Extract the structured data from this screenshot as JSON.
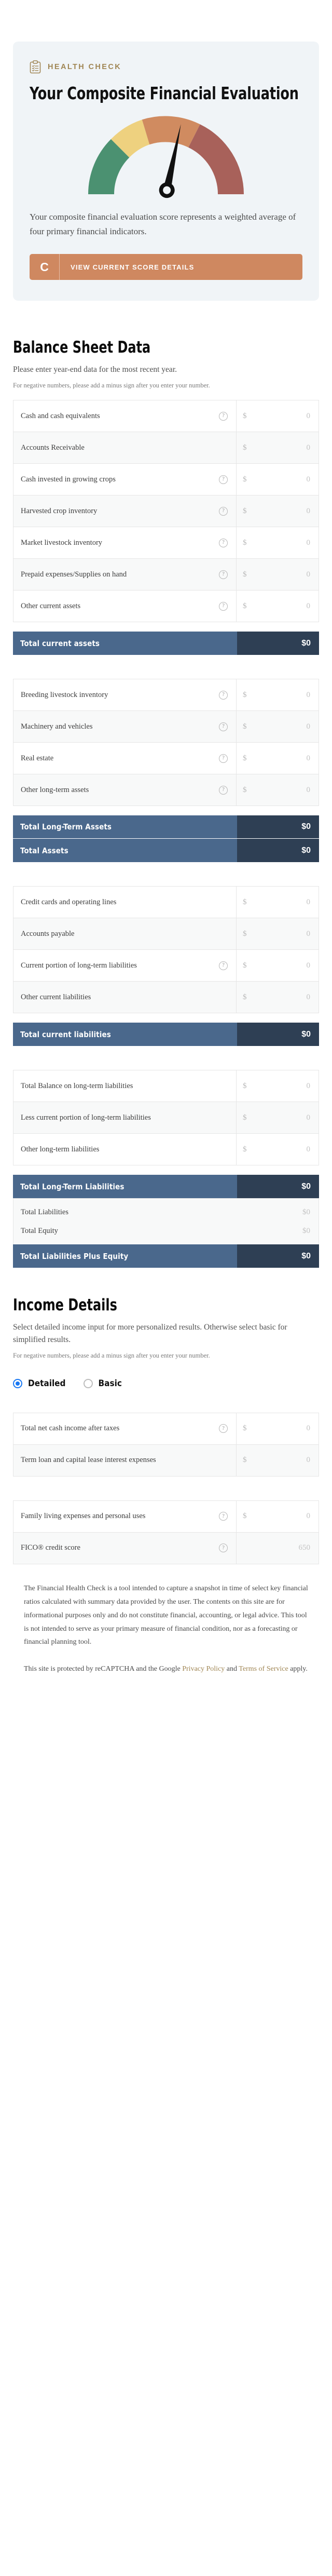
{
  "health_check": {
    "eyebrow": "HEALTH CHECK",
    "icon": "clipboard-check-icon",
    "title": "Your Composite Financial Evaluation",
    "description": "Your composite financial evaluation score represents a weighted average of four primary financial indicators.",
    "grade": "C",
    "button_label": "VIEW CURRENT SCORE DETAILS",
    "gauge": {
      "needle_angle_deg": 12,
      "segments": [
        {
          "name": "strong",
          "color": "#4b9171",
          "start_deg": -90,
          "end_deg": -45
        },
        {
          "name": "stable",
          "color": "#eed17f",
          "start_deg": -45,
          "end_deg": -13
        },
        {
          "name": "caution",
          "color": "#d08b60",
          "start_deg": -13,
          "end_deg": 26
        },
        {
          "name": "weak",
          "color": "#a8615a",
          "start_deg": 26,
          "end_deg": 90
        }
      ]
    }
  },
  "balance_sheet": {
    "title": "Balance Sheet Data",
    "subtitle": "Please enter year-end data for the most recent year.",
    "note": "For negative numbers, please add a minus sign after you enter your number.",
    "currency_symbol": "$",
    "amount_placeholder": "0",
    "help_glyph": "?",
    "current_assets": [
      {
        "label": "Cash and cash equivalents",
        "help": true,
        "value": ""
      },
      {
        "label": "Accounts Receivable",
        "help": false,
        "value": ""
      },
      {
        "label": "Cash invested in growing crops",
        "help": true,
        "value": ""
      },
      {
        "label": "Harvested crop inventory",
        "help": true,
        "value": ""
      },
      {
        "label": "Market livestock inventory",
        "help": true,
        "value": ""
      },
      {
        "label": "Prepaid expenses/Supplies on hand",
        "help": true,
        "value": ""
      },
      {
        "label": "Other current assets",
        "help": true,
        "value": ""
      }
    ],
    "current_assets_total": {
      "label": "Total current assets",
      "value": "$0"
    },
    "long_term_assets": [
      {
        "label": "Breeding livestock inventory",
        "help": true,
        "value": ""
      },
      {
        "label": "Machinery and vehicles",
        "help": true,
        "value": ""
      },
      {
        "label": "Real estate",
        "help": true,
        "value": ""
      },
      {
        "label": "Other long-term assets",
        "help": true,
        "value": ""
      }
    ],
    "asset_totals": [
      {
        "label": "Total Long-Term Assets",
        "value": "$0"
      },
      {
        "label": "Total Assets",
        "value": "$0"
      }
    ],
    "current_liabilities": [
      {
        "label": "Credit cards and operating lines",
        "help": false,
        "value": ""
      },
      {
        "label": "Accounts payable",
        "help": false,
        "value": ""
      },
      {
        "label": "Current portion of long-term liabilities",
        "help": true,
        "value": ""
      },
      {
        "label": "Other current liabilities",
        "help": false,
        "value": ""
      }
    ],
    "current_liabilities_total": {
      "label": "Total current liabilities",
      "value": "$0"
    },
    "long_term_liabilities": [
      {
        "label": "Total Balance on long-term liabilities",
        "help": false,
        "value": ""
      },
      {
        "label": "Less current portion of long-term liabilities",
        "help": false,
        "value": ""
      },
      {
        "label": "Other long-term liabilities",
        "help": false,
        "value": ""
      }
    ],
    "long_term_liabilities_total": {
      "label": "Total Long-Term Liabilities",
      "value": "$0"
    },
    "calculated": [
      {
        "label": "Total Liabilities",
        "value": "$0"
      },
      {
        "label": "Total Equity",
        "value": "$0"
      }
    ],
    "grand_total": {
      "label": "Total Liabilities Plus Equity",
      "value": "$0"
    }
  },
  "income_details": {
    "title": "Income Details",
    "subtitle": "Select detailed income input for more personalized results. Otherwise select basic for simplified results.",
    "note": "For negative numbers, please add a minus sign after you enter your number.",
    "mode_options": [
      {
        "label": "Detailed",
        "selected": true
      },
      {
        "label": "Basic",
        "selected": false
      }
    ],
    "rows_group_one": [
      {
        "label": "Total net cash income after taxes",
        "help": true,
        "prefix": "$",
        "placeholder": "0",
        "value": ""
      },
      {
        "label": "Term loan and capital lease interest expenses",
        "help": false,
        "prefix": "$",
        "placeholder": "0",
        "value": ""
      }
    ],
    "rows_group_two": [
      {
        "label": "Family living expenses and personal uses",
        "help": true,
        "prefix": "$",
        "placeholder": "0",
        "value": ""
      },
      {
        "label": "FICO® credit score",
        "help": true,
        "prefix": "",
        "placeholder": "650",
        "value": ""
      }
    ]
  },
  "disclaimer": {
    "paragraph_one": "The Financial Health Check is a tool intended to capture a snapshot in time of select key financial ratios calculated with summary data provided by the user. The contents on this site are for informational purposes only and do not constitute financial, accounting, or legal advice. This tool is not intended to serve as your primary measure of financial condition, nor as a forecasting or financial planning tool.",
    "recaptcha_prefix": "This site is protected by reCAPTCHA and the Google ",
    "privacy_policy": "Privacy Policy",
    "recaptcha_mid": " and ",
    "terms_of_service": "Terms of Service",
    "recaptcha_suffix": " apply."
  },
  "colors": {
    "accent_gold": "#a08654",
    "button_orange": "#cf8860",
    "total_blue": "#4a688c",
    "total_navy": "#2e3f54",
    "radio_blue": "#1877f2",
    "card_bg": "#f0f4f7"
  }
}
